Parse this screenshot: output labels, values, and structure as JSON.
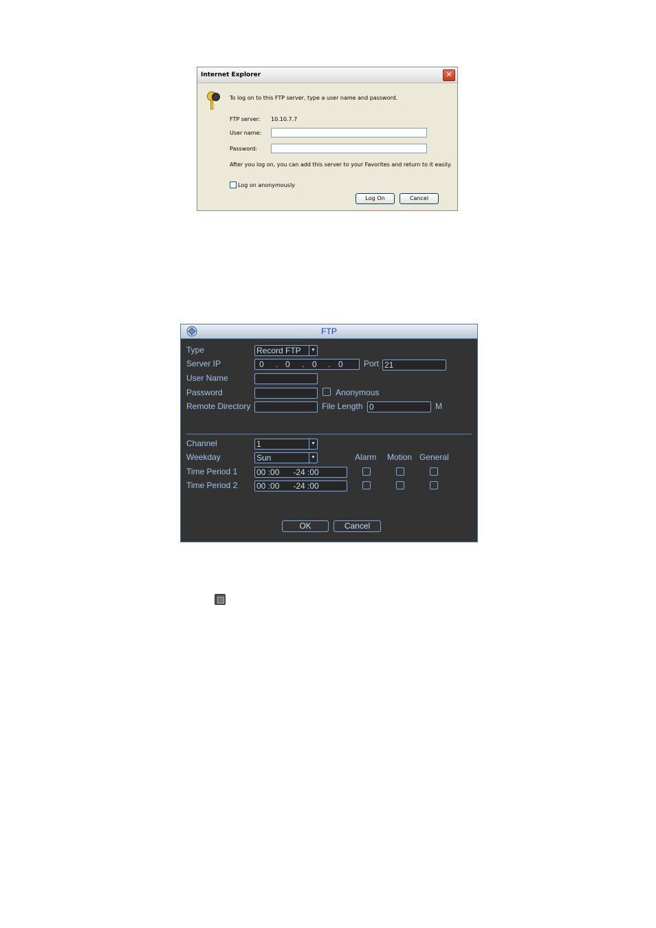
{
  "ie_dialog": {
    "title": "Internet Explorer",
    "close_glyph": "✕",
    "prompt": "To log on to this FTP server, type a user name and password.",
    "server_label": "FTP server:",
    "server_value": "10.10.7.7",
    "username_label": "User name:",
    "username_value": "",
    "password_label": "Password:",
    "password_value": "",
    "info": "After you log on, you can add this server to your Favorites and return to it easily.",
    "anonymous_label": "Log on anonymously",
    "anonymous_checked": false,
    "logon_button": "Log On",
    "cancel_button": "Cancel",
    "icon": "key-icon"
  },
  "ftp_panel": {
    "title": "FTP",
    "icon": "dvr-logo-icon",
    "type_label": "Type",
    "type_value": "Record FTP",
    "server_ip_label": "Server IP",
    "ip": [
      "0",
      "0",
      "0",
      "0"
    ],
    "ip_dot": ".",
    "port_label": "Port",
    "port_value": "21",
    "username_label": "User Name",
    "username_value": "",
    "password_label": "Password",
    "password_value": "",
    "anonymous_label": "Anonymous",
    "remote_dir_label": "Remote Directory",
    "remote_dir_value": "",
    "file_length_label": "File Length",
    "file_length_value": "0",
    "file_length_unit": "M",
    "channel_label": "Channel",
    "channel_value": "1",
    "weekday_label": "Weekday",
    "weekday_value": "Sun",
    "col_alarm": "Alarm",
    "col_motion": "Motion",
    "col_general": "General",
    "period1_label": "Time Period 1",
    "period1_value": "00 :00      -24 :00",
    "period2_label": "Time Period 2",
    "period2_value": "00 :00      -24 :00",
    "ok_button": "OK",
    "cancel_button": "Cancel",
    "dropdown_glyph": "▼"
  }
}
